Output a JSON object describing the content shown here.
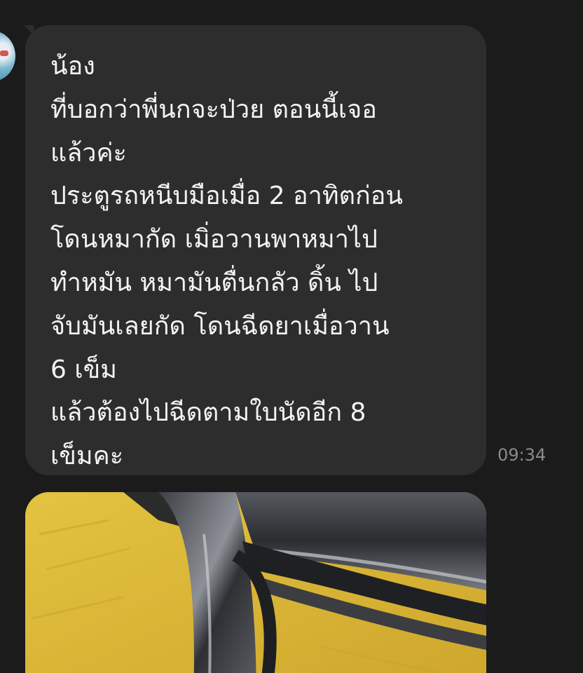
{
  "message": {
    "lines": [
      "น้อง",
      "ที่บอกว่าพี่นกจะป่วย  ตอนนี้เจอ",
      "แล้วค่ะ",
      "ประตูรถหนีบมือเมื่อ 2 อาทิตก่อน",
      "โดนหมากัด  เมิ่อวานพาหมาไป",
      "ทำหมัน  หมามันตื่นกลัว  ดิ้น  ไป",
      "จับมันเลยกัด  โดนฉีดยาเมื่อวาน",
      "6 เข็ม",
      "แล้วต้องไปฉีดตามใบนัดอีก 8",
      "เข็มคะ"
    ],
    "time": "09:34"
  },
  "colors": {
    "background": "#1b1b1b",
    "bubble": "#2d2d2d",
    "text": "#f3f3f3",
    "timestamp": "#8a8a8a"
  }
}
